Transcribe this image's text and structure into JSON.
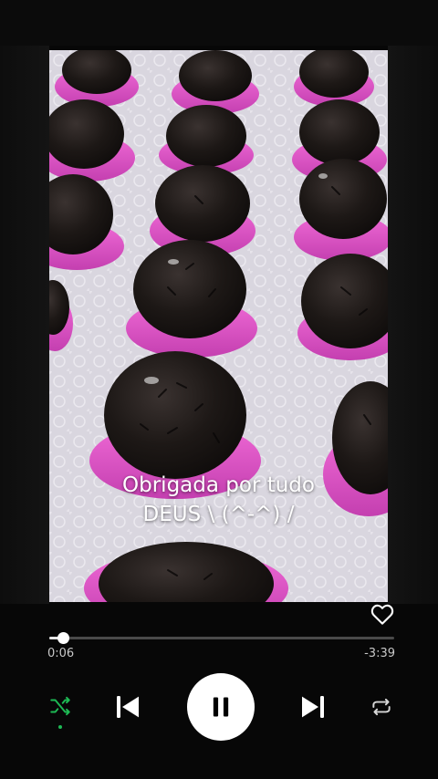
{
  "caption": {
    "line1": "Obrigada por tudo",
    "line2": "DEUS \\ (^-^) /"
  },
  "player": {
    "elapsed": "0:06",
    "remaining": "-3:39",
    "progress_fraction": 0.04,
    "is_playing": true,
    "is_liked": false,
    "shuffle_active": true,
    "accent_color": "#1db954"
  },
  "icons": {
    "like": "heart-outline-icon",
    "shuffle": "shuffle-icon",
    "previous": "skip-previous-icon",
    "play_pause": "pause-icon",
    "next": "skip-next-icon",
    "repeat": "repeat-icon"
  }
}
